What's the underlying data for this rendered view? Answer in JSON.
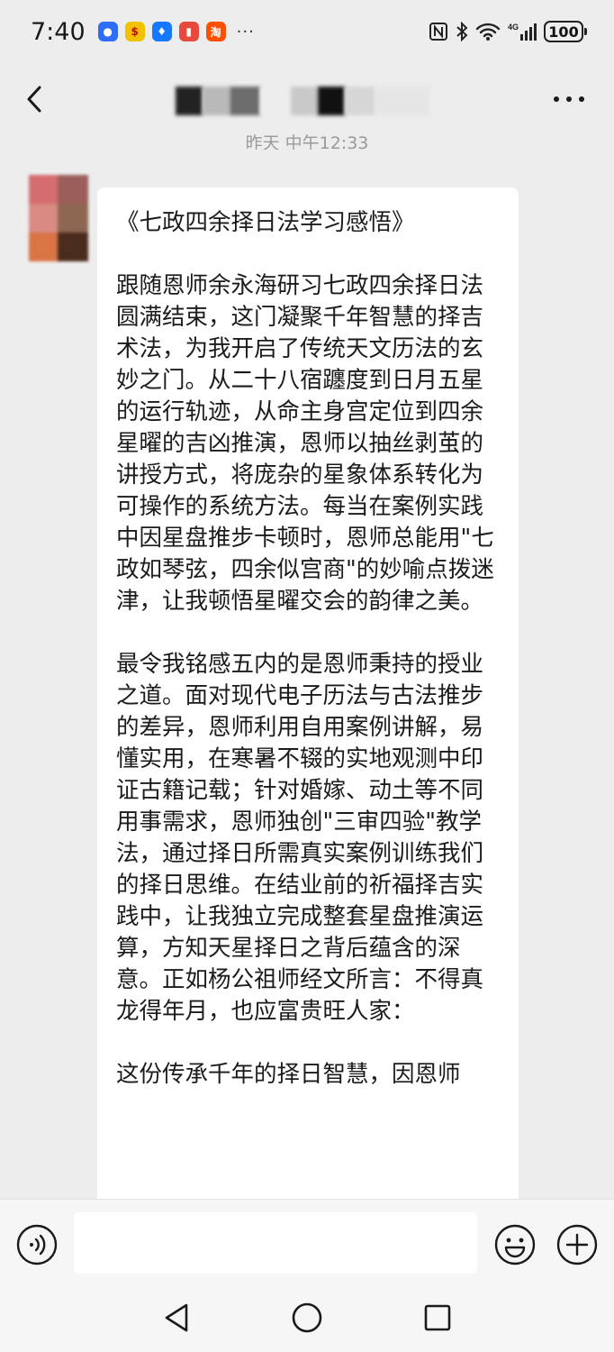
{
  "status_bar": {
    "time": "7:40",
    "more_indicator": "···",
    "battery": "100",
    "network": "4G",
    "app_icons": [
      {
        "name": "app-icon-blue",
        "color": "#2f6df6"
      },
      {
        "name": "app-icon-yellow",
        "color": "#f2c200"
      },
      {
        "name": "app-icon-bulb",
        "color": "#1677ff"
      },
      {
        "name": "app-icon-book",
        "color": "#e64a3c"
      },
      {
        "name": "app-icon-taobao",
        "color": "#ff5000"
      }
    ]
  },
  "header": {
    "back_icon": "chevron-left-icon",
    "more_icon": "more-horizontal-icon"
  },
  "chat": {
    "timestamp": "昨天 中午12:33",
    "message": {
      "title": "《七政四余择日法学习感悟》",
      "paragraphs": [
        "跟随恩师余永海研习七政四余择日法圆满结束，这门凝聚千年智慧的择吉术法，为我开启了传统天文历法的玄妙之门。从二十八宿躔度到日月五星的运行轨迹，从命主身宫定位到四余星曜的吉凶推演，恩师以抽丝剥茧的讲授方式，将庞杂的星象体系转化为可操作的系统方法。每当在案例实践中因星盘推步卡顿时，恩师总能用\"七政如琴弦，四余似宫商\"的妙喻点拨迷津，让我顿悟星曜交会的韵律之美。",
        "最令我铭感五内的是恩师秉持的授业之道。面对现代电子历法与古法推步的差异，恩师利用自用案例讲解，易懂实用，在寒暑不辍的实地观测中印证古籍记载；针对婚嫁、动土等不同用事需求，恩师独创\"三审四验\"教学法，通过择日所需真实案例训练我们的择日思维。在结业前的祈福择吉实践中，让我独立完成整套星盘推演运算，方知天星择日之背后蕴含的深意。正如杨公祖师经文所言：不得真龙得年月，也应富贵旺人家：",
        "这份传承千年的择日智慧，因恩师"
      ]
    }
  },
  "input_bar": {
    "voice_icon": "voice-icon",
    "input_value": "",
    "emoji_icon": "emoji-icon",
    "plus_icon": "plus-icon"
  },
  "nav_bar": {
    "back_icon": "nav-back-icon",
    "home_icon": "nav-home-icon",
    "recent_icon": "nav-recent-icon"
  }
}
